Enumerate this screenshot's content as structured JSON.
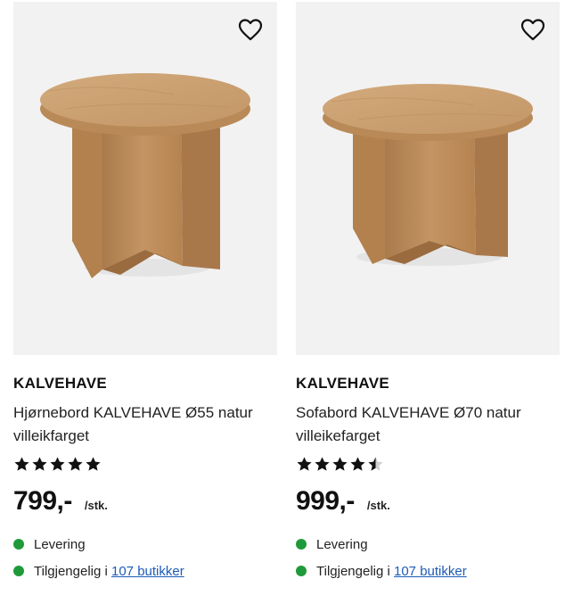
{
  "products": [
    {
      "brand": "KALVEHAVE",
      "title_line1": "Hjørnebord KALVEHAVE Ø55 natur",
      "title_line2": "villeikfarget",
      "rating": 5,
      "price": "799,-",
      "unit": "/stk.",
      "delivery": "Levering",
      "availability_prefix": "Tilgjengelig i ",
      "stores_link": "107 butikker",
      "wishlist_icon": "heart-outline-icon"
    },
    {
      "brand": "KALVEHAVE",
      "title_line1": "Sofabord KALVEHAVE Ø70 natur",
      "title_line2": "villeikefarget",
      "rating": 4.5,
      "price": "999,-",
      "unit": "/stk.",
      "delivery": "Levering",
      "availability_prefix": "Tilgjengelig i ",
      "stores_link": "107 butikker",
      "wishlist_icon": "heart-outline-icon"
    }
  ],
  "colors": {
    "status_green": "#1f9a3a",
    "link_blue": "#1d5bb8",
    "image_bg": "#f2f2f2",
    "oak": "#c79b6a"
  }
}
